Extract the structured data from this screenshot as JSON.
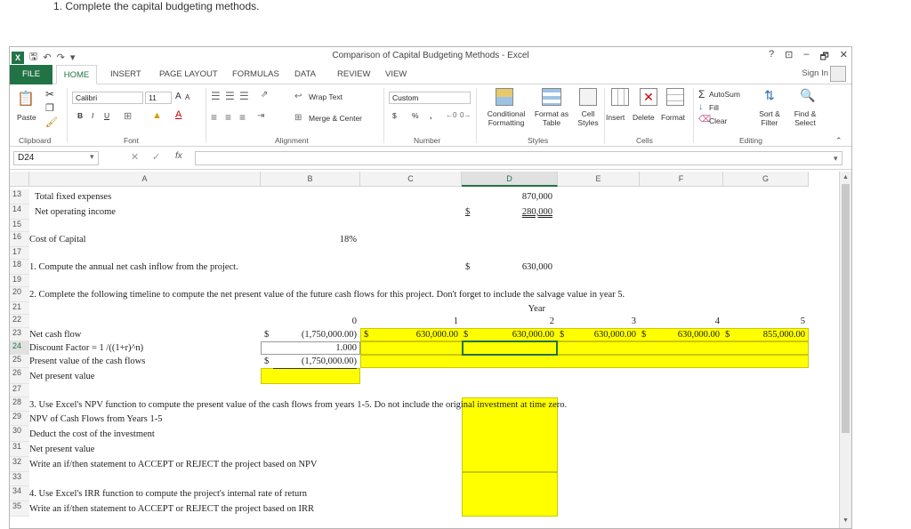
{
  "instruction": "1. Complete the capital budgeting methods.",
  "window": {
    "title": "Comparison of Capital Budgeting Methods - Excel",
    "controls": [
      "?",
      "⊡",
      "–",
      "🗗",
      "✕"
    ]
  },
  "menu": {
    "tabs": [
      "FILE",
      "HOME",
      "INSERT",
      "PAGE LAYOUT",
      "FORMULAS",
      "DATA",
      "REVIEW",
      "VIEW"
    ],
    "sign_in": "Sign In"
  },
  "ribbon": {
    "clipboard": {
      "paste": "Paste",
      "label": "Clipboard"
    },
    "font": {
      "name": "Calibri",
      "size": "11",
      "grow": "A",
      "shrink": "A",
      "bold": "B",
      "italic": "I",
      "underline": "U",
      "label": "Font"
    },
    "alignment": {
      "wrap": "Wrap Text",
      "merge": "Merge & Center",
      "label": "Alignment"
    },
    "number": {
      "format": "Custom",
      "currency": "$",
      "percent": "%",
      "comma": ",",
      "label": "Number"
    },
    "styles": {
      "conditional": "Conditional Formatting",
      "format_table": "Format as Table",
      "cell_styles": "Cell Styles",
      "label": "Styles"
    },
    "cells": {
      "insert": "Insert",
      "delete": "Delete",
      "format": "Format",
      "label": "Cells"
    },
    "editing": {
      "autosum": "AutoSum",
      "fill": "Fill",
      "clear": "Clear",
      "sort": "Sort & Filter",
      "find": "Find & Select",
      "label": "Editing"
    }
  },
  "formula_bar": {
    "name_box": "D24",
    "fx": "fx",
    "value": ""
  },
  "columns": [
    "A",
    "B",
    "C",
    "D",
    "E",
    "F",
    "G"
  ],
  "rows": {
    "r13": {
      "num": "13",
      "a": "Total fixed expenses",
      "d": "870,000"
    },
    "r14": {
      "num": "14",
      "a": "Net operating income",
      "d_sym": "$",
      "d": "280,000"
    },
    "r15": {
      "num": "15"
    },
    "r16": {
      "num": "16",
      "a": "Cost of Capital",
      "b": "18%"
    },
    "r17": {
      "num": "17"
    },
    "r18": {
      "num": "18",
      "a": "1. Compute the annual net cash inflow from the project.",
      "d_sym": "$",
      "d": "630,000"
    },
    "r19": {
      "num": "19"
    },
    "r20": {
      "num": "20",
      "a": "2.  Complete the following timeline to compute the net present value of the future cash flows for this project.  Don't forget to include the salvage value in year 5."
    },
    "r21": {
      "num": "21",
      "d": "Year"
    },
    "r22": {
      "num": "22",
      "years": [
        "0",
        "1",
        "2",
        "3",
        "4",
        "5"
      ]
    },
    "r23": {
      "num": "23",
      "a": "Net cash flow",
      "sym": "$",
      "b": "(1,750,000.00)",
      "c": "630,000.00",
      "d": "630,000.00",
      "e": "630,000.00",
      "f": "630,000.00",
      "g": "855,000.00"
    },
    "r24": {
      "num": "24",
      "a": "Discount Factor = 1 /((1+r)^n)",
      "b": "1.000"
    },
    "r25": {
      "num": "25",
      "a": "Present value of the cash flows",
      "sym": "$",
      "b": "(1,750,000.00)"
    },
    "r26": {
      "num": "26",
      "a": "Net present value"
    },
    "r27": {
      "num": "27"
    },
    "r28": {
      "num": "28",
      "a": "3.  Use Excel's NPV function to compute the present value of the cash flows from years 1-5.  Do not include the original investment at time zero."
    },
    "r29": {
      "num": "29",
      "a": "NPV of Cash Flows from Years 1-5"
    },
    "r30": {
      "num": "30",
      "a": "Deduct the cost of the investment"
    },
    "r31": {
      "num": "31",
      "a": "Net present value"
    },
    "r32": {
      "num": "32",
      "a": "Write an if/then statement to ACCEPT or REJECT the project based on NPV"
    },
    "r33": {
      "num": "33"
    },
    "r34": {
      "num": "34",
      "a": "4. Use Excel's IRR function to compute the project's internal rate of return"
    },
    "r35": {
      "num": "35",
      "a": "Write an if/then statement to ACCEPT or REJECT the project based on IRR"
    }
  },
  "colors": {
    "excel_green": "#217346",
    "highlight": "#ffff00"
  }
}
